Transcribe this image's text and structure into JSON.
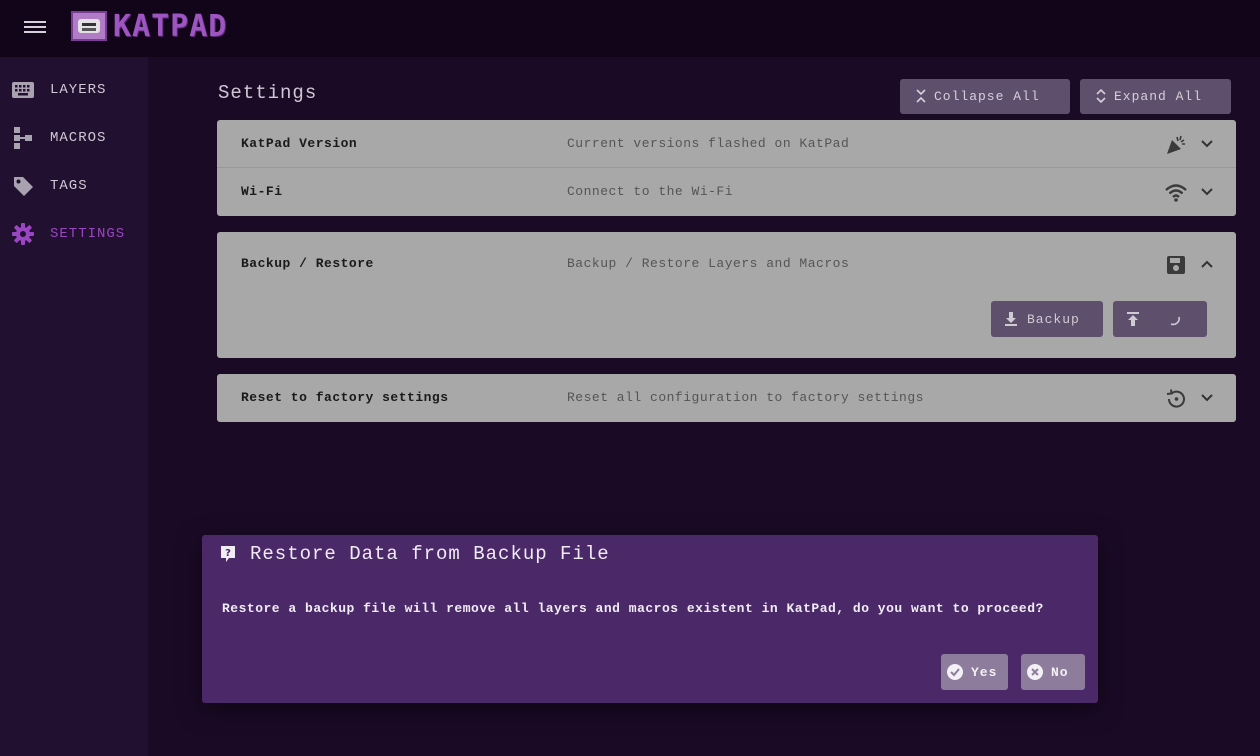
{
  "app": {
    "logo_text": "KATPAD"
  },
  "sidebar": {
    "items": [
      {
        "label": "LAYERS",
        "icon": "keyboard-icon"
      },
      {
        "label": "MACROS",
        "icon": "macro-tree-icon"
      },
      {
        "label": "TAGS",
        "icon": "tag-icon"
      },
      {
        "label": "SETTINGS",
        "icon": "gear-icon",
        "active": true
      }
    ]
  },
  "main": {
    "title": "Settings",
    "collapse_label": "Collapse All",
    "expand_label": "Expand All",
    "sections": [
      {
        "title": "KatPad Version",
        "description": "Current versions flashed on KatPad",
        "icon": "party-popper-icon"
      },
      {
        "title": "Wi-Fi",
        "description": "Connect to the Wi-Fi",
        "icon": "wifi-icon"
      },
      {
        "title": "Backup / Restore",
        "description": "Backup / Restore Layers and Macros",
        "icon": "floppy-disk-icon",
        "expanded": true
      },
      {
        "title": "Reset to factory settings",
        "description": "Reset all configuration to factory settings",
        "icon": "history-icon"
      }
    ],
    "backup_label": "Backup"
  },
  "dialog": {
    "title": "Restore Data from Backup File",
    "message": "Restore a backup file will remove all layers and macros existent in KatPad, do you want to proceed?",
    "yes_label": "Yes",
    "no_label": "No"
  },
  "colors": {
    "accent": "#9a45c2",
    "background": "#1b0a26",
    "sidebar": "#221030",
    "panel": "#a8a8a8",
    "dialog": "#4b2969",
    "button": "#5e4f6c"
  }
}
